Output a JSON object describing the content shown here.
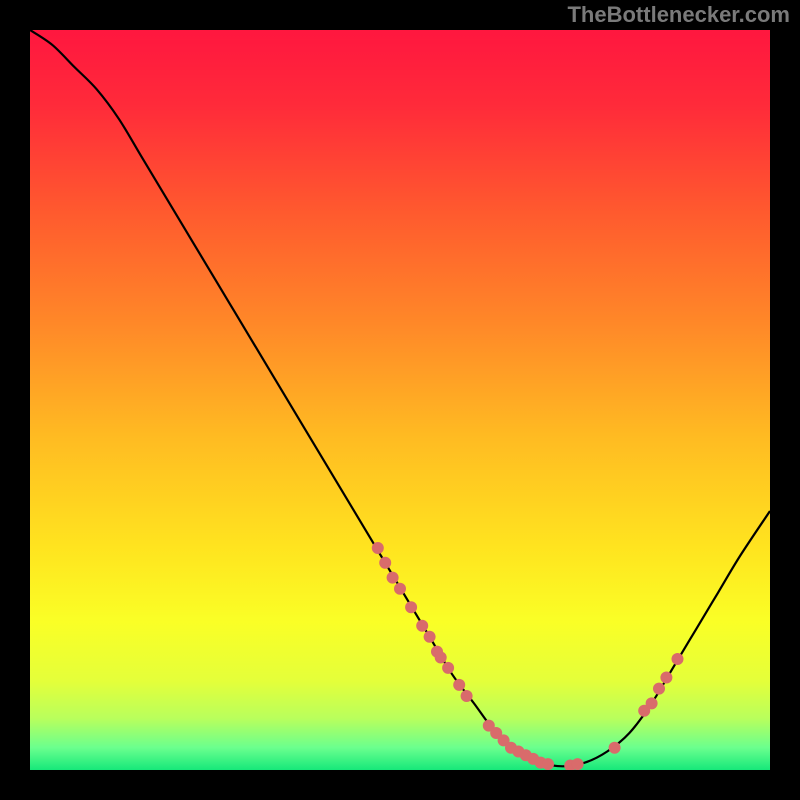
{
  "watermark": "TheBottlenecker.com",
  "chart_data": {
    "type": "line",
    "title": "",
    "xlabel": "",
    "ylabel": "",
    "xlim": [
      0,
      100
    ],
    "ylim": [
      0,
      100
    ],
    "gradient_stops": [
      {
        "offset": 0.0,
        "color": "#ff173f"
      },
      {
        "offset": 0.1,
        "color": "#ff2a3a"
      },
      {
        "offset": 0.25,
        "color": "#ff5b2e"
      },
      {
        "offset": 0.4,
        "color": "#ff8928"
      },
      {
        "offset": 0.55,
        "color": "#ffbb22"
      },
      {
        "offset": 0.7,
        "color": "#ffe41f"
      },
      {
        "offset": 0.8,
        "color": "#faff26"
      },
      {
        "offset": 0.88,
        "color": "#e4ff3a"
      },
      {
        "offset": 0.93,
        "color": "#b9ff5c"
      },
      {
        "offset": 0.97,
        "color": "#6aff8e"
      },
      {
        "offset": 1.0,
        "color": "#16e87a"
      }
    ],
    "curve": [
      {
        "x": 0,
        "y": 100
      },
      {
        "x": 3,
        "y": 98
      },
      {
        "x": 6,
        "y": 95
      },
      {
        "x": 9,
        "y": 92
      },
      {
        "x": 12,
        "y": 88
      },
      {
        "x": 15,
        "y": 83
      },
      {
        "x": 18,
        "y": 78
      },
      {
        "x": 21,
        "y": 73
      },
      {
        "x": 24,
        "y": 68
      },
      {
        "x": 27,
        "y": 63
      },
      {
        "x": 30,
        "y": 58
      },
      {
        "x": 33,
        "y": 53
      },
      {
        "x": 36,
        "y": 48
      },
      {
        "x": 39,
        "y": 43
      },
      {
        "x": 42,
        "y": 38
      },
      {
        "x": 45,
        "y": 33
      },
      {
        "x": 48,
        "y": 28
      },
      {
        "x": 51,
        "y": 23
      },
      {
        "x": 54,
        "y": 18
      },
      {
        "x": 57,
        "y": 13
      },
      {
        "x": 60,
        "y": 9
      },
      {
        "x": 63,
        "y": 5
      },
      {
        "x": 66,
        "y": 2.5
      },
      {
        "x": 69,
        "y": 1
      },
      {
        "x": 72,
        "y": 0.5
      },
      {
        "x": 75,
        "y": 1
      },
      {
        "x": 78,
        "y": 2.5
      },
      {
        "x": 81,
        "y": 5
      },
      {
        "x": 84,
        "y": 9
      },
      {
        "x": 87,
        "y": 14
      },
      {
        "x": 90,
        "y": 19
      },
      {
        "x": 93,
        "y": 24
      },
      {
        "x": 96,
        "y": 29
      },
      {
        "x": 100,
        "y": 35
      }
    ],
    "scatter": [
      {
        "x": 47,
        "y": 30
      },
      {
        "x": 48,
        "y": 28
      },
      {
        "x": 49,
        "y": 26
      },
      {
        "x": 50,
        "y": 24.5
      },
      {
        "x": 51.5,
        "y": 22
      },
      {
        "x": 53,
        "y": 19.5
      },
      {
        "x": 54,
        "y": 18
      },
      {
        "x": 55,
        "y": 16
      },
      {
        "x": 55.5,
        "y": 15.2
      },
      {
        "x": 56.5,
        "y": 13.8
      },
      {
        "x": 58,
        "y": 11.5
      },
      {
        "x": 59,
        "y": 10
      },
      {
        "x": 62,
        "y": 6
      },
      {
        "x": 63,
        "y": 5
      },
      {
        "x": 64,
        "y": 4
      },
      {
        "x": 65,
        "y": 3
      },
      {
        "x": 66,
        "y": 2.5
      },
      {
        "x": 67,
        "y": 2
      },
      {
        "x": 68,
        "y": 1.5
      },
      {
        "x": 69,
        "y": 1
      },
      {
        "x": 70,
        "y": 0.8
      },
      {
        "x": 73,
        "y": 0.6
      },
      {
        "x": 74,
        "y": 0.8
      },
      {
        "x": 79,
        "y": 3
      },
      {
        "x": 83,
        "y": 8
      },
      {
        "x": 84,
        "y": 9
      },
      {
        "x": 85,
        "y": 11
      },
      {
        "x": 86,
        "y": 12.5
      },
      {
        "x": 87.5,
        "y": 15
      }
    ],
    "scatter_color": "#d96b6b",
    "scatter_radius": 6
  }
}
